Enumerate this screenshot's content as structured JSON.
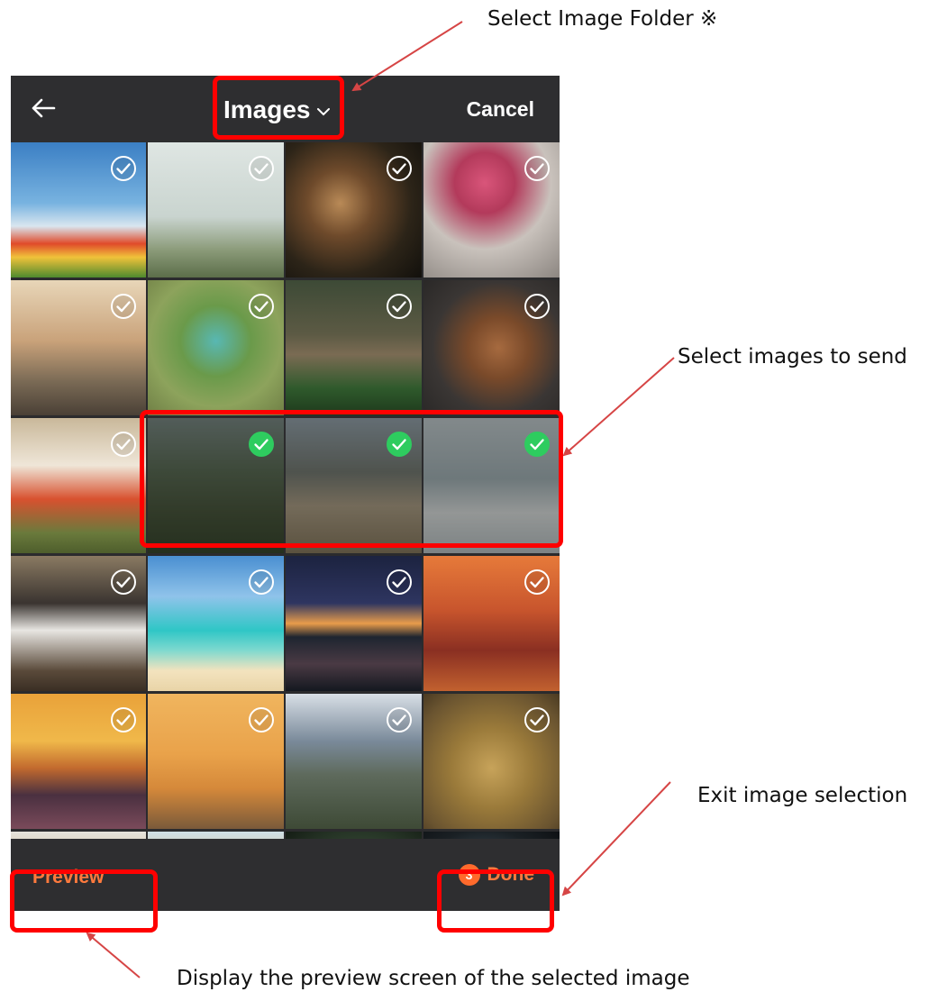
{
  "annotations": {
    "folder": "Select Image Folder ※",
    "select": "Select images to send",
    "exit": "Exit image selection",
    "preview": "Display the preview screen of the selected image"
  },
  "header": {
    "title": "Images",
    "cancel_label": "Cancel",
    "back_icon": "back-arrow-icon",
    "chevron_icon": "chevron-down-icon"
  },
  "grid": {
    "tiles": [
      {
        "id": "balloon-tulips",
        "selected": false
      },
      {
        "id": "palm-trees",
        "selected": false
      },
      {
        "id": "jay-bird",
        "selected": false
      },
      {
        "id": "pink-peonies",
        "selected": false
      },
      {
        "id": "venice-canal",
        "selected": false
      },
      {
        "id": "bee-eaters",
        "selected": false
      },
      {
        "id": "lynx",
        "selected": false
      },
      {
        "id": "abyssinian-cat",
        "selected": false
      },
      {
        "id": "french-bulldog",
        "selected": false
      },
      {
        "id": "woman-field",
        "selected": true
      },
      {
        "id": "woman-dog-mountains",
        "selected": true
      },
      {
        "id": "surfer",
        "selected": true
      },
      {
        "id": "husky-man",
        "selected": false
      },
      {
        "id": "beach-boat",
        "selected": false
      },
      {
        "id": "tree-milkyway",
        "selected": false
      },
      {
        "id": "golden-gate",
        "selected": false
      },
      {
        "id": "palm-sunset",
        "selected": false
      },
      {
        "id": "vintage-car",
        "selected": false
      },
      {
        "id": "elk",
        "selected": false
      },
      {
        "id": "lion",
        "selected": false
      },
      {
        "id": "eagle",
        "selected": false
      },
      {
        "id": "giraffe",
        "selected": false
      },
      {
        "id": "flower-bird",
        "selected": false
      },
      {
        "id": "heron",
        "selected": false
      }
    ]
  },
  "footer": {
    "preview_label": "Preview",
    "done_count": "3",
    "done_label": "Done"
  },
  "colors": {
    "accent": "#ff7a3d",
    "badge": "#ff6a2c",
    "check_selected": "#2ecc5f",
    "highlight": "#ff0000",
    "bar": "#2e2e30"
  }
}
